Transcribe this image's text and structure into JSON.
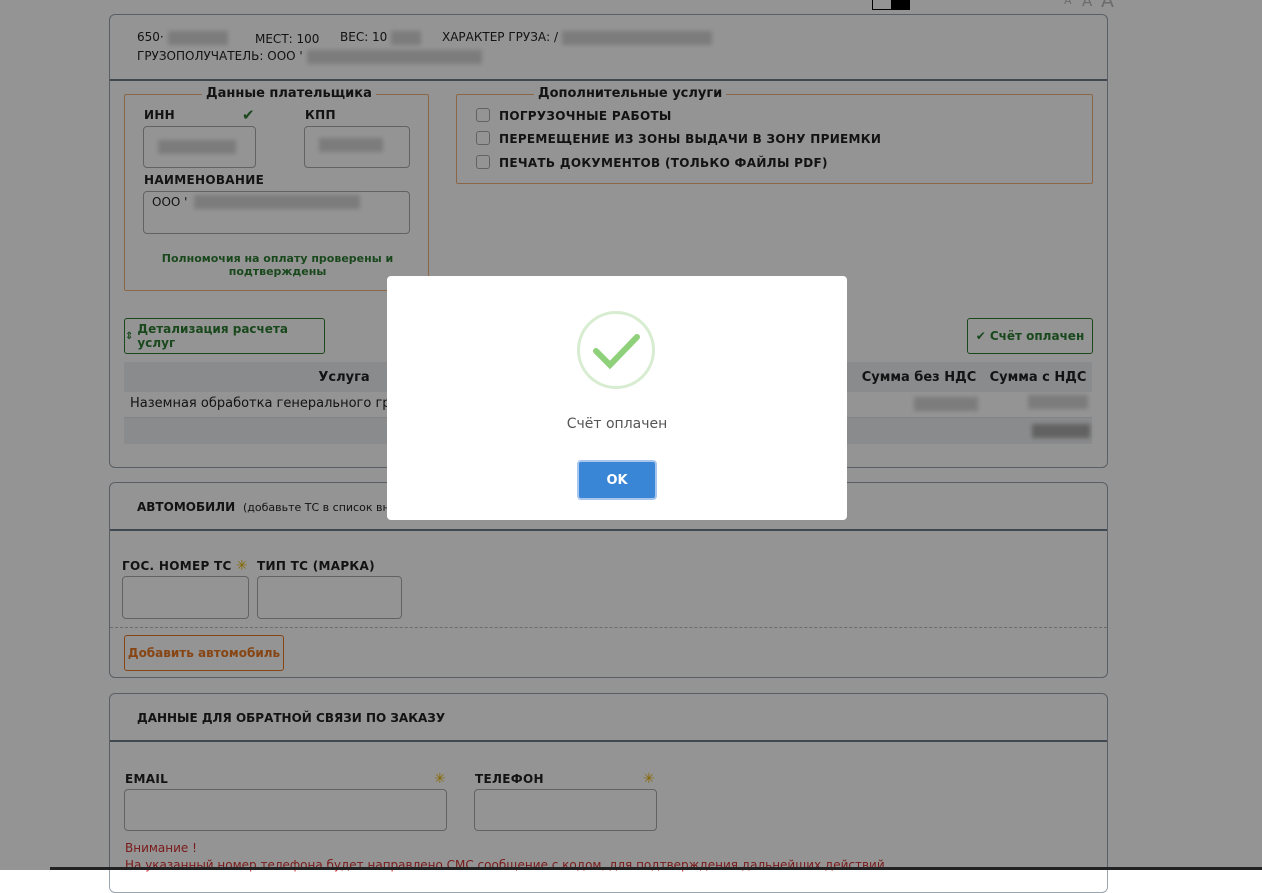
{
  "top_controls": {
    "font_small": "A",
    "font_medium": "A",
    "font_large": "A"
  },
  "cargo": {
    "number_prefix": "650·",
    "places_label": "МЕСТ: 100",
    "weight_label": "ВЕС: 10",
    "cargo_type_label": "ХАРАКТЕР ГРУЗА:",
    "cargo_type_prefix": "/",
    "consignee_label": "ГРУЗОПОЛУЧАТЕЛЬ: ООО '"
  },
  "payer": {
    "legend": "Данные плательщика",
    "inn_label": "ИНН",
    "kpp_label": "КПП",
    "name_label": "НАИМЕНОВАНИЕ",
    "name_prefix": "ООО '",
    "authority_note": "Полномочия на оплату проверены и подтверждены"
  },
  "services": {
    "legend": "Дополнительные услуги",
    "options": [
      {
        "label": "ПОГРУЗОЧНЫЕ РАБОТЫ",
        "checked": false
      },
      {
        "label": "ПЕРЕМЕЩЕНИЕ ИЗ ЗОНЫ ВЫДАЧИ В ЗОНУ ПРИЕМКИ",
        "checked": false
      },
      {
        "label": "ПЕЧАТЬ ДОКУМЕНТОВ (ТОЛЬКО ФАЙЛЫ PDF)",
        "checked": false
      }
    ]
  },
  "actions": {
    "details_button": "Детализация расчета услуг",
    "paid_button": "Счёт оплачен"
  },
  "table": {
    "headers": [
      "Услуга",
      "Сумма без НДС",
      "Сумма с НДС"
    ],
    "rows": [
      {
        "service": "Наземная обработка генерального груза"
      }
    ]
  },
  "cars": {
    "title": "АВТОМОБИЛИ",
    "hint": "(добавьте ТС в список внизу)",
    "plate_label": "ГОС. НОМЕР ТС",
    "type_label": "ТИП ТС (МАРКА)",
    "add_button": "Добавить автомобиль"
  },
  "feedback": {
    "title": "ДАННЫЕ ДЛЯ ОБРАТНОЙ СВЯЗИ ПО ЗАКАЗУ",
    "email_label": "EMAIL",
    "phone_label": "ТЕЛЕФОН",
    "warning_title": "Внимание !",
    "warning_text": "На указанный номер телефона будет направлено СМС сообщение с кодом, для подтверждения дальнейших действий"
  },
  "modal": {
    "message": "Счёт оплачен",
    "ok_label": "OK"
  },
  "colors": {
    "accent_green": "#2e7d32",
    "accent_orange": "#e87722",
    "ok_blue": "#3a86d6",
    "success_check": "#8fd07a",
    "warning_red": "#d32f2f"
  }
}
